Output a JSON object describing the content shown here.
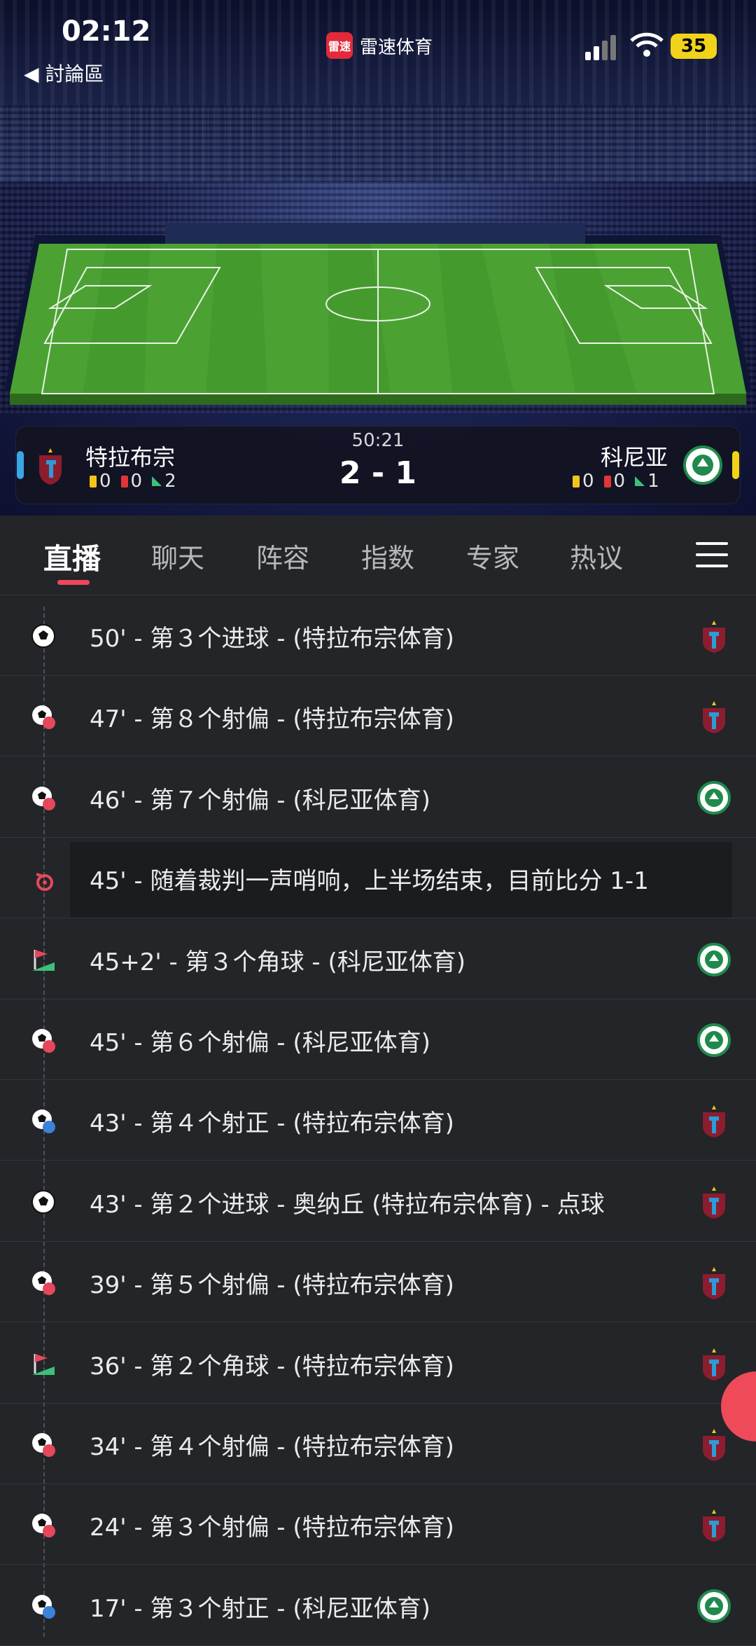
{
  "status_bar": {
    "time": "02:12",
    "back_label": "◀ 討論區",
    "battery": "35"
  },
  "app": {
    "title": "雷速体育",
    "logo_text": "雷速"
  },
  "match": {
    "time": "50:21",
    "score": "2 - 1",
    "home": {
      "name": "特拉布宗",
      "yellow": "0",
      "red": "0",
      "corners": "2"
    },
    "away": {
      "name": "科尼亚",
      "yellow": "0",
      "red": "0",
      "corners": "1"
    }
  },
  "tabs": [
    "直播",
    "聊天",
    "阵容",
    "指数",
    "专家",
    "热议"
  ],
  "events": [
    {
      "type": "goal",
      "team": "home",
      "text": "50' - 第３个进球 - (特拉布宗体育)"
    },
    {
      "type": "miss",
      "team": "home",
      "text": "47' - 第８个射偏 - (特拉布宗体育)"
    },
    {
      "type": "miss",
      "team": "away",
      "text": "46' - 第７个射偏 - (科尼亚体育)"
    },
    {
      "type": "whistle",
      "team": "",
      "text": "45' - 随着裁判一声哨响，上半场结束，目前比分 1-1"
    },
    {
      "type": "corner",
      "team": "away",
      "text": "45+2' - 第３个角球 - (科尼亚体育)"
    },
    {
      "type": "miss",
      "team": "away",
      "text": "45' - 第６个射偏 - (科尼亚体育)"
    },
    {
      "type": "ontarget",
      "team": "home",
      "text": "43' - 第４个射正 - (特拉布宗体育)"
    },
    {
      "type": "goal",
      "team": "home",
      "text": "43' - 第２个进球 - 奥纳丘 (特拉布宗体育) - 点球"
    },
    {
      "type": "miss",
      "team": "home",
      "text": "39' - 第５个射偏 - (特拉布宗体育)"
    },
    {
      "type": "corner",
      "team": "home",
      "text": "36' - 第２个角球 - (特拉布宗体育)"
    },
    {
      "type": "miss",
      "team": "home",
      "text": "34' - 第４个射偏 - (特拉布宗体育)"
    },
    {
      "type": "miss",
      "team": "home",
      "text": "24' - 第３个射偏 - (特拉布宗体育)"
    },
    {
      "type": "ontarget",
      "team": "away",
      "text": "17' - 第３个射正 - (科尼亚体育)"
    }
  ],
  "colors": {
    "accent": "#f0475c",
    "home_marker": "#39a6e8",
    "away_marker": "#f2d31b",
    "background": "#232529"
  }
}
